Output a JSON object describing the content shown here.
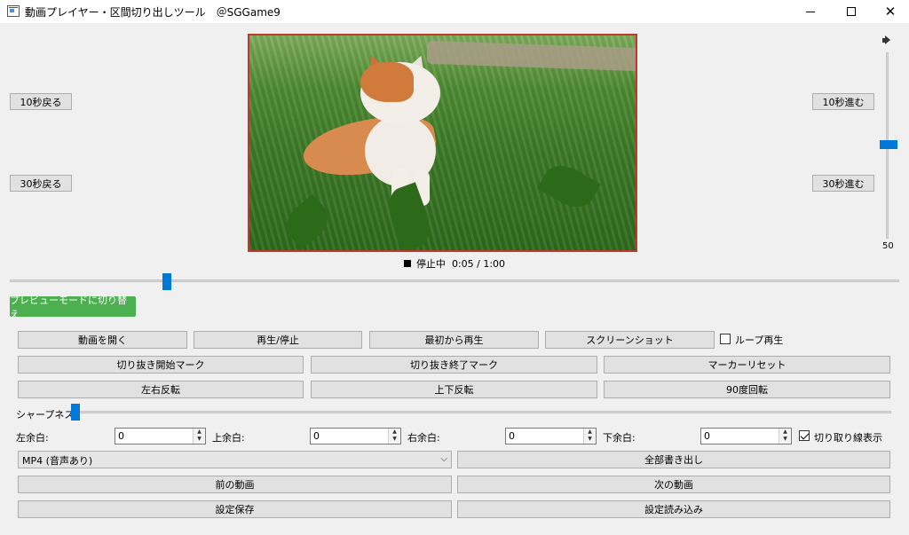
{
  "window": {
    "title": "動画プレイヤー・区間切り出しツール　＠SGGame9"
  },
  "nav": {
    "back10": "10秒戻る",
    "back30": "30秒戻る",
    "fwd10": "10秒進む",
    "fwd30": "30秒進む"
  },
  "player": {
    "status": "停止中",
    "time": "0:05 / 1:00",
    "progress": 0.083
  },
  "volume": {
    "value": "50",
    "level": 0.5
  },
  "preview_button": "プレビューモードに切り替え",
  "row1": {
    "open": "動画を開く",
    "play_pause": "再生/停止",
    "restart": "最初から再生",
    "screenshot": "スクリーンショット",
    "loop_label": "ループ再生",
    "loop_checked": false
  },
  "row2": {
    "mark_start": "切り抜き開始マーク",
    "mark_end": "切り抜き終了マーク",
    "reset_markers": "マーカーリセット"
  },
  "row3": {
    "flip_h": "左右反転",
    "flip_v": "上下反転",
    "rotate90": "90度回転"
  },
  "sharpness": {
    "label": "シャープネス:",
    "level": 0.0
  },
  "margins": {
    "left_label": "左余白:",
    "left_value": "0",
    "top_label": "上余白:",
    "top_value": "0",
    "right_label": "右余白:",
    "right_value": "0",
    "bottom_label": "下余白:",
    "bottom_value": "0",
    "show_crop_label": "切り取り線表示",
    "show_crop_checked": true
  },
  "export": {
    "format": "MP4 (音声あり)",
    "export_all": "全部書き出し"
  },
  "navigation": {
    "prev_video": "前の動画",
    "next_video": "次の動画"
  },
  "settings": {
    "save": "設定保存",
    "load": "設定読み込み"
  },
  "colors": {
    "accent": "#0078d7",
    "preview_button": "#4caf50",
    "video_border": "#c0392b"
  }
}
